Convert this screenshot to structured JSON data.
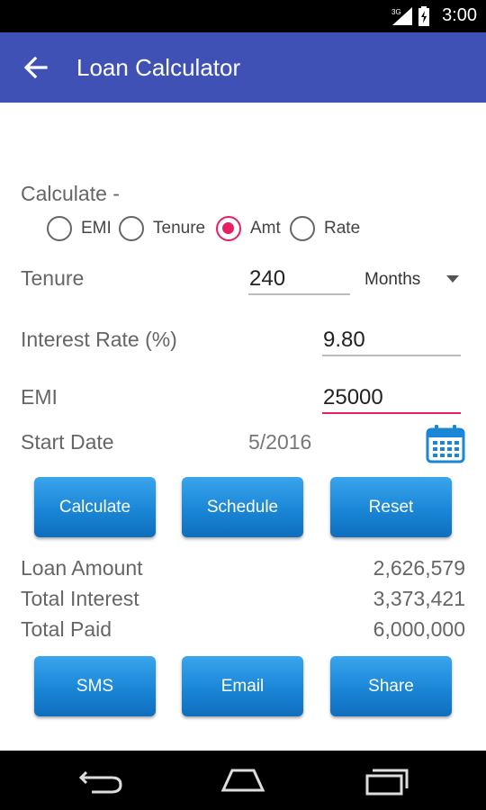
{
  "status_bar": {
    "network": "3G",
    "time": "3:00"
  },
  "app_bar": {
    "title": "Loan Calculator",
    "back_icon": "arrow-back-icon"
  },
  "form": {
    "calculate_label": "Calculate -",
    "options": [
      {
        "label": "EMI",
        "checked": false
      },
      {
        "label": "Tenure",
        "checked": false
      },
      {
        "label": "Amt",
        "checked": true
      },
      {
        "label": "Rate",
        "checked": false
      }
    ],
    "tenure_label": "Tenure",
    "tenure_value": "240",
    "tenure_unit": "Months",
    "interest_label": "Interest Rate (%)",
    "interest_value": "9.80",
    "emi_label": "EMI",
    "emi_value": "25000",
    "start_date_label": "Start Date",
    "start_date_value": "5/2016"
  },
  "actions": {
    "calculate": "Calculate",
    "schedule": "Schedule",
    "reset": "Reset"
  },
  "results": {
    "loan_amount_label": "Loan Amount",
    "loan_amount_value": "2,626,579",
    "total_interest_label": "Total Interest",
    "total_interest_value": "3,373,421",
    "total_paid_label": "Total Paid",
    "total_paid_value": "6,000,000"
  },
  "share_actions": {
    "sms": "SMS",
    "email": "Email",
    "share": "Share"
  },
  "colors": {
    "app_bar": "#3f51b5",
    "accent": "#e91e63",
    "button": "#1a86d6"
  }
}
